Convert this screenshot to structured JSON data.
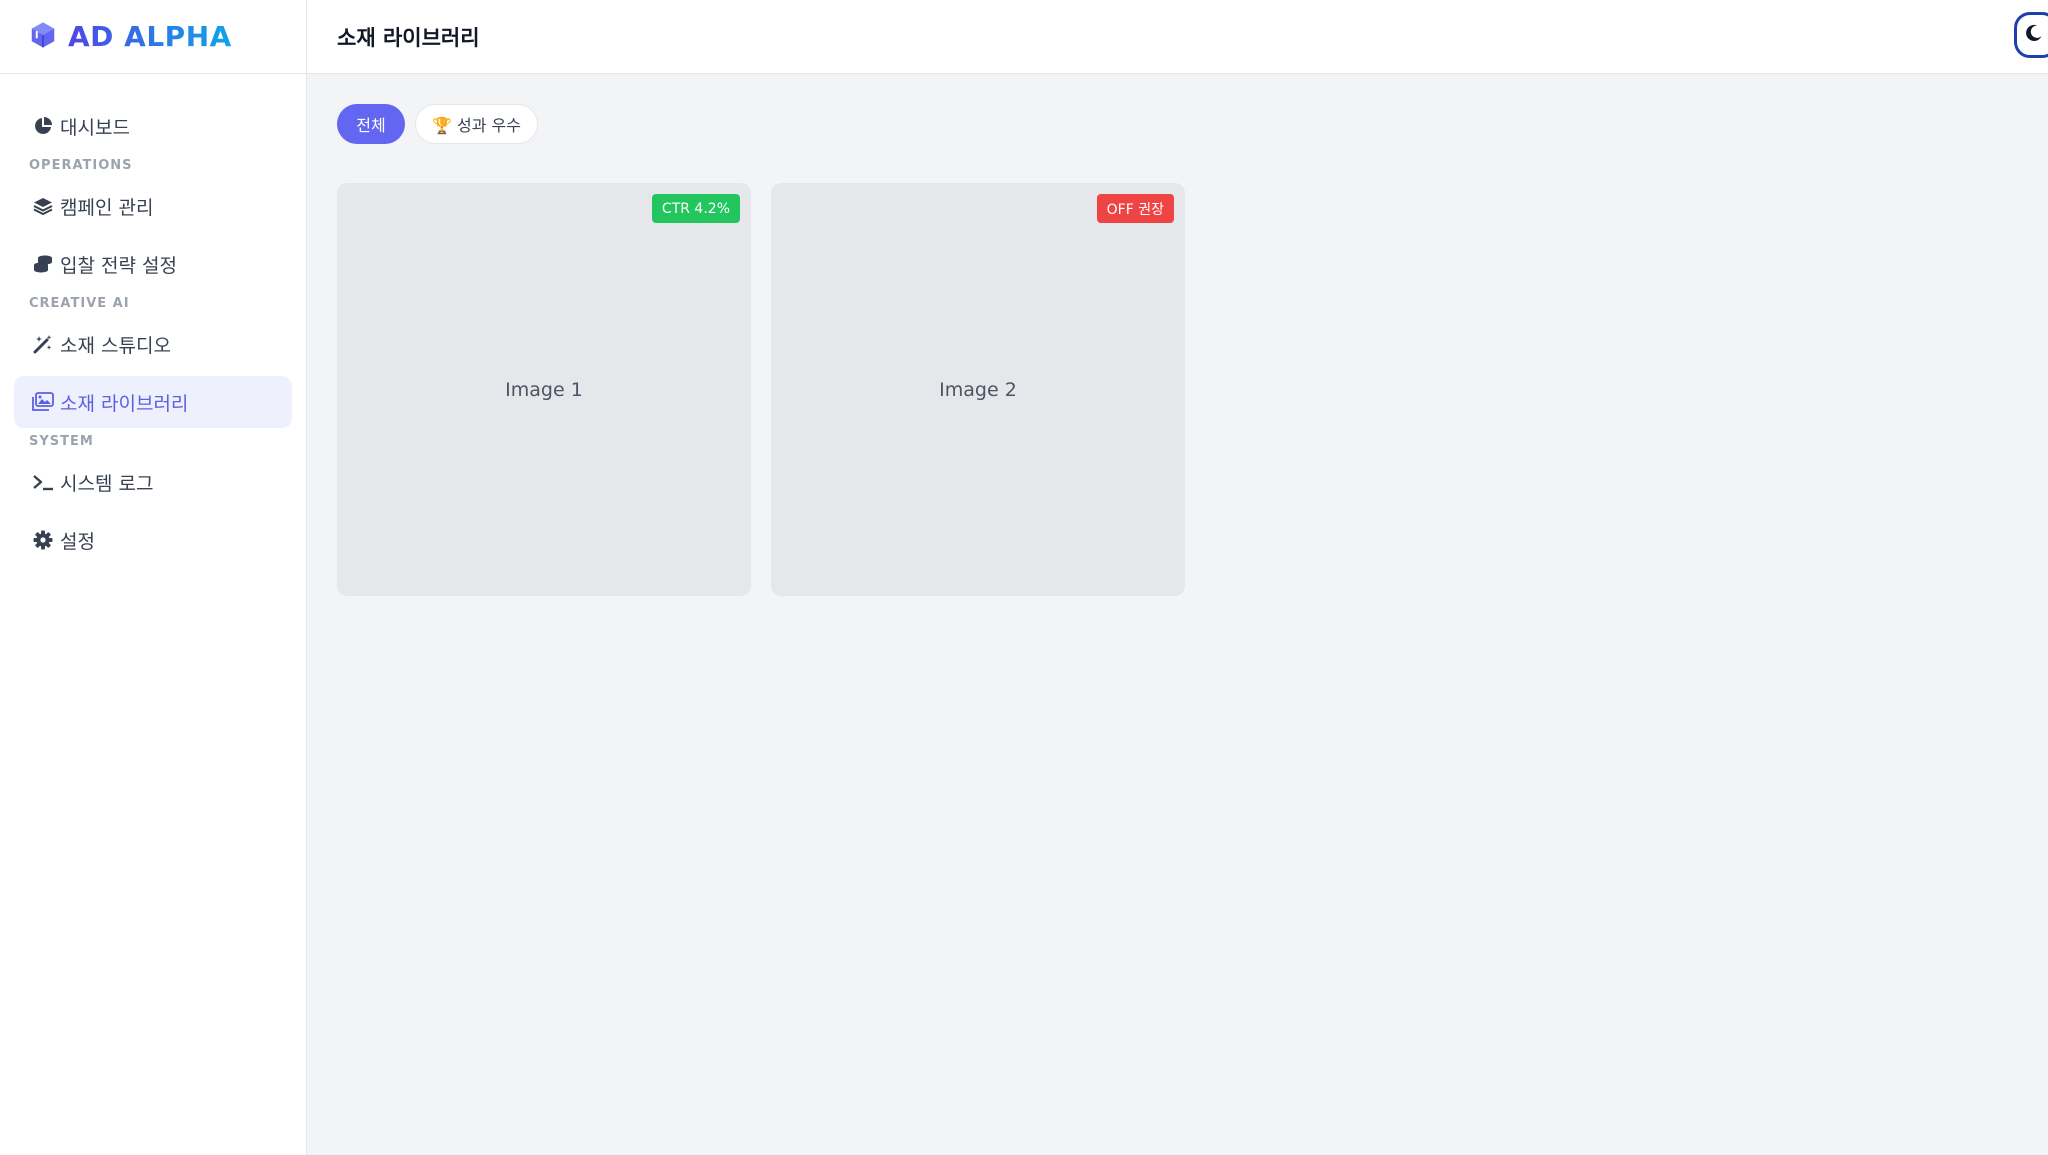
{
  "brand": {
    "name": "AD ALPHA",
    "icon": "cube-icon"
  },
  "sidebar": {
    "items": [
      {
        "label": "대시보드",
        "icon": "pie-chart-icon"
      },
      {
        "section": "OPERATIONS"
      },
      {
        "label": "캠페인 관리",
        "icon": "layers-icon"
      },
      {
        "label": "입찰 전략 설정",
        "icon": "coins-icon"
      },
      {
        "section": "CREATIVE AI"
      },
      {
        "label": "소재 스튜디오",
        "icon": "magic-wand-icon"
      },
      {
        "label": "소재 라이브러리",
        "icon": "images-icon",
        "active": true
      },
      {
        "section": "SYSTEM"
      },
      {
        "label": "시스템 로그",
        "icon": "terminal-icon"
      },
      {
        "label": "설정",
        "icon": "gear-icon"
      }
    ]
  },
  "header": {
    "title": "소재 라이브러리",
    "theme_toggle_icon": "moon-icon"
  },
  "filters": [
    {
      "label": "전체",
      "active": true
    },
    {
      "label": "🏆 성과 우수",
      "active": false
    }
  ],
  "cards": [
    {
      "label": "Image 1",
      "badge": "CTR 4.2%",
      "badge_color": "#22c55e"
    },
    {
      "label": "Image 2",
      "badge": "OFF 권장",
      "badge_color": "#ef4444"
    }
  ],
  "colors": {
    "accent": "#6366f1",
    "active_bg": "#eef0fe",
    "success": "#22c55e",
    "danger": "#ef4444"
  }
}
